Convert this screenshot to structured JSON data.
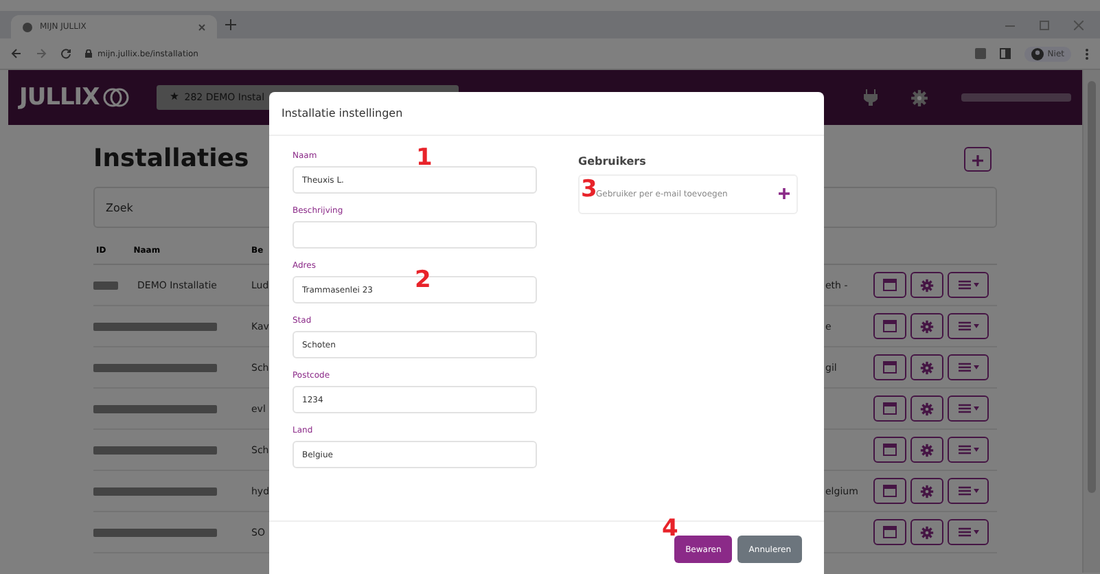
{
  "browser": {
    "tab_title": "MIJN JULLIX",
    "url": "mijn.jullix.be/installation",
    "profile_label": "Niet"
  },
  "header": {
    "logo": "JULLIX",
    "installation_selector": "282 DEMO Instal"
  },
  "page": {
    "title": "Installaties",
    "search_placeholder": "Zoek",
    "columns": [
      "ID",
      "Naam",
      "Be"
    ],
    "rows": [
      {
        "name": "DEMO Installatie",
        "column_3": "Lud",
        "column_4": "eth -"
      },
      {
        "column_3": "Kav",
        "column_4": "e"
      },
      {
        "column_3": "Sch",
        "column_4": "gil"
      },
      {
        "column_3": "evl"
      },
      {
        "column_3": "Sch"
      },
      {
        "column_3": "hyd",
        "column_4": "elgium"
      },
      {
        "column_3": "SO"
      }
    ]
  },
  "dialog": {
    "title": "Installatie instellingen",
    "fields": [
      {
        "label": "Naam",
        "value": "Theuxis L."
      },
      {
        "label": "Beschrijving"
      },
      {
        "label": "Adres",
        "value": "Trammasenlei 23"
      },
      {
        "label": "Stad",
        "value": "Schoten"
      },
      {
        "label": "Postcode",
        "value": "1234"
      },
      {
        "label": "Land",
        "value": "Belgiue"
      }
    ],
    "users_title": "Gebruikers",
    "add_user_placeholder": "Gebruiker per e-mail toevoegen",
    "buttons": [
      {
        "label": "Bewaren",
        "kind": "primary"
      },
      {
        "label": "Annuleren",
        "kind": "secondary"
      }
    ]
  },
  "annotations": [
    "1",
    "2",
    "3",
    "4"
  ]
}
